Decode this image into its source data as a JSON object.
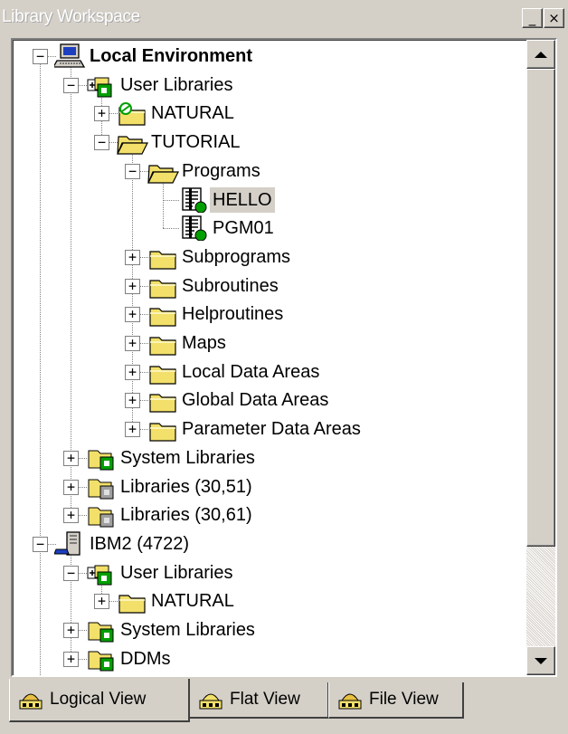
{
  "window": {
    "title": "Library Workspace",
    "minimize_glyph": "_",
    "close_glyph": "×"
  },
  "tree": {
    "nodes": [
      {
        "label": "Local Environment",
        "icon": "computer-icon",
        "level": 0,
        "expander": "−",
        "bold": true
      },
      {
        "label": "User Libraries",
        "icon": "user-libraries-icon",
        "level": 1,
        "expander": "−"
      },
      {
        "label": "NATURAL",
        "icon": "linked-folder-icon",
        "level": 2,
        "expander": "+"
      },
      {
        "label": "TUTORIAL",
        "icon": "open-folder-icon",
        "level": 2,
        "expander": "−"
      },
      {
        "label": "Programs",
        "icon": "open-folder-icon",
        "level": 3,
        "expander": "−"
      },
      {
        "label": "HELLO",
        "icon": "program-icon",
        "level": 4,
        "expander": "",
        "selected": true
      },
      {
        "label": "PGM01",
        "icon": "program-icon",
        "level": 4,
        "expander": ""
      },
      {
        "label": "Subprograms",
        "icon": "folder-icon",
        "level": 3,
        "expander": "+"
      },
      {
        "label": "Subroutines",
        "icon": "folder-icon",
        "level": 3,
        "expander": "+"
      },
      {
        "label": "Helproutines",
        "icon": "folder-icon",
        "level": 3,
        "expander": "+"
      },
      {
        "label": "Maps",
        "icon": "folder-icon",
        "level": 3,
        "expander": "+"
      },
      {
        "label": "Local Data Areas",
        "icon": "folder-icon",
        "level": 3,
        "expander": "+"
      },
      {
        "label": "Global Data Areas",
        "icon": "folder-icon",
        "level": 3,
        "expander": "+"
      },
      {
        "label": "Parameter Data Areas",
        "icon": "folder-icon",
        "level": 3,
        "expander": "+"
      },
      {
        "label": "System Libraries",
        "icon": "system-libraries-icon",
        "level": 1,
        "expander": "+"
      },
      {
        "label": "Libraries (30,51)",
        "icon": "gray-libraries-icon",
        "level": 1,
        "expander": "+"
      },
      {
        "label": "Libraries (30,61)",
        "icon": "gray-libraries-icon",
        "level": 1,
        "expander": "+"
      },
      {
        "label": "IBM2 (4722)",
        "icon": "server-icon",
        "level": 0,
        "expander": "−"
      },
      {
        "label": "User Libraries",
        "icon": "user-libraries-icon",
        "level": 1,
        "expander": "−"
      },
      {
        "label": "NATURAL",
        "icon": "folder-icon",
        "level": 2,
        "expander": "+"
      },
      {
        "label": "System Libraries",
        "icon": "system-libraries-icon",
        "level": 1,
        "expander": "+"
      },
      {
        "label": "DDMs",
        "icon": "system-libraries-icon",
        "level": 1,
        "expander": "+"
      }
    ]
  },
  "tabs": [
    {
      "label": "Logical View",
      "icon": "logical-view-icon",
      "active": true
    },
    {
      "label": "Flat View",
      "icon": "flat-view-icon",
      "active": false
    },
    {
      "label": "File View",
      "icon": "file-view-icon",
      "active": false
    }
  ],
  "colors": {
    "folder_yellow": "#f2e06a",
    "status_green": "#00a000",
    "chrome": "#d4d0c8"
  }
}
